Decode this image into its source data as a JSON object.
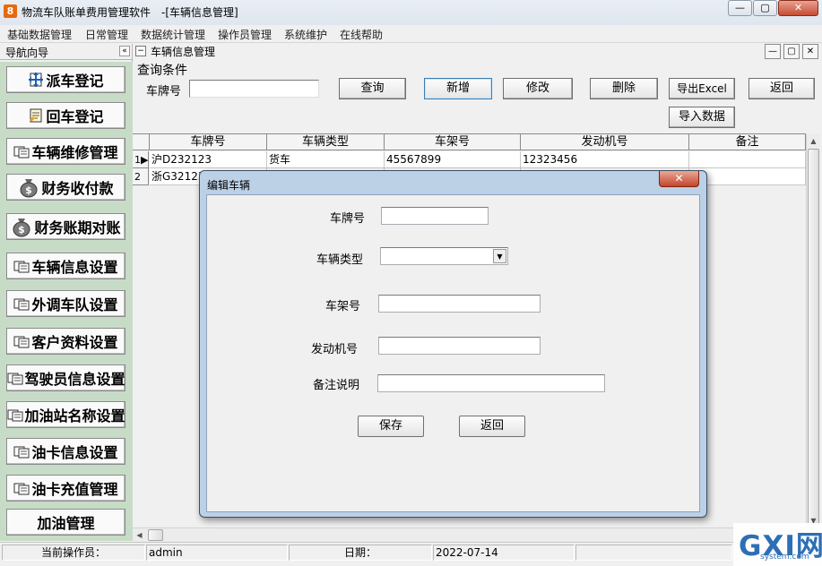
{
  "window": {
    "app_icon_char": "8",
    "title": "物流车队账单费用管理软件　-[车辆信息管理]",
    "controls": {
      "min": "—",
      "max": "▢",
      "close": "✕"
    }
  },
  "menu": [
    "基础数据管理",
    "日常管理",
    "数据统计管理",
    "操作员管理",
    "系统维护",
    "在线帮助"
  ],
  "nav": {
    "title": "导航向导",
    "collapse": "«",
    "items": [
      {
        "label": "派车登记",
        "icon": "dispatch-icon"
      },
      {
        "label": "回车登记",
        "icon": "return-icon"
      },
      {
        "label": "车辆维修管理",
        "icon": "form-icon"
      },
      {
        "label": "财务收付款",
        "icon": "money-bag-icon"
      },
      {
        "label": "财务账期对账",
        "icon": "money-bag-icon"
      },
      {
        "label": "车辆信息设置",
        "icon": "form-icon"
      },
      {
        "label": "外调车队设置",
        "icon": "form-icon"
      },
      {
        "label": "客户资料设置",
        "icon": "form-icon"
      },
      {
        "label": "驾驶员信息设置",
        "icon": "form-icon"
      },
      {
        "label": "加油站名称设置",
        "icon": "form-icon"
      },
      {
        "label": "油卡信息设置",
        "icon": "form-icon"
      },
      {
        "label": "油卡充值管理",
        "icon": "form-icon"
      },
      {
        "label": "加油管理",
        "icon": ""
      }
    ]
  },
  "child": {
    "title": "车辆信息管理",
    "query_group": "查询条件",
    "plate_label": "车牌号",
    "plate_value": "",
    "buttons": {
      "query": "查询",
      "add": "新增",
      "edit": "修改",
      "delete": "删除",
      "export": "导出Excel",
      "back": "返回",
      "import": "导入数据"
    }
  },
  "grid": {
    "columns": [
      "车牌号",
      "车辆类型",
      "车架号",
      "发动机号",
      "备注"
    ],
    "rows": [
      {
        "num": "1",
        "marker": "▶",
        "cells": [
          "沪D232123",
          "货车",
          "45567899",
          "12323456",
          ""
        ]
      },
      {
        "num": "2",
        "marker": "",
        "cells": [
          "浙G32123",
          "",
          "",
          "",
          ""
        ]
      }
    ]
  },
  "status": {
    "operator_label": "当前操作员：",
    "operator": "admin",
    "date_label": "日期：",
    "date": "2022-07-14"
  },
  "dialog": {
    "title": "编辑车辆",
    "close": "✕",
    "fields": {
      "plate": {
        "label": "车牌号",
        "value": ""
      },
      "type": {
        "label": "车辆类型",
        "value": ""
      },
      "frame": {
        "label": "车架号",
        "value": ""
      },
      "engine": {
        "label": "发动机号",
        "value": ""
      },
      "remark": {
        "label": "备注说明",
        "value": ""
      }
    },
    "save": "保存",
    "back": "返回"
  },
  "watermark": {
    "big": "GXI网",
    "small": "system.com"
  }
}
